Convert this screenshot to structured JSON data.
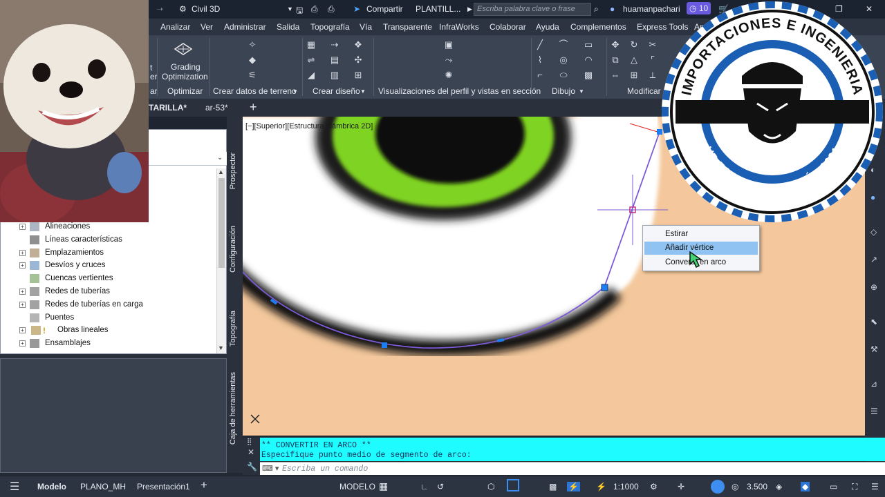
{
  "titlebar": {
    "workspace": "Civil 3D",
    "share": "Compartir",
    "doc_title": "PLANTILL...",
    "search_placeholder": "Escriba palabra clave o frase",
    "user": "huamanpachari",
    "notif_count": "10"
  },
  "menubar": [
    "Analizar",
    "Ver",
    "Administrar",
    "Salida",
    "Topografía",
    "Vía",
    "Transparente",
    "InfraWorks",
    "Colaborar",
    "Ayuda",
    "Complementos",
    "Express Tools",
    "Ap"
  ],
  "ribbon": {
    "grading_label_1": "Grading",
    "grading_label_2": "Optimization",
    "panels": [
      "Optimizar",
      "Crear datos de terreno",
      "Crear diseño",
      "Visualizaciones del perfil y vistas en sección",
      "Dibujo",
      "Modificar"
    ],
    "clipped_left": "ar",
    "clipped_left_top": "t",
    "clipped_left_mid": "er"
  },
  "doctabs": [
    "TARILLA*",
    "ar-53*"
  ],
  "toolspace": {
    "tree": [
      {
        "label": "Alineaciones",
        "expand": true
      },
      {
        "label": "Líneas características",
        "expand": false
      },
      {
        "label": "Emplazamientos",
        "expand": true
      },
      {
        "label": "Desvíos y cruces",
        "expand": true
      },
      {
        "label": "Cuencas vertientes",
        "expand": false
      },
      {
        "label": "Redes de tuberías",
        "expand": true
      },
      {
        "label": "Redes de tuberías en carga",
        "expand": true
      },
      {
        "label": "Puentes",
        "expand": false
      },
      {
        "label": "Obras lineales",
        "expand": true
      },
      {
        "label": "Ensamblajes",
        "expand": true
      }
    ]
  },
  "side_tabs": [
    "Prospector",
    "Configuración",
    "Topografía",
    "Caja de herramientas"
  ],
  "viewport": {
    "label": "[−][Superior][Estructura alámbrica 2D]",
    "ucs_label": "SCU"
  },
  "context_menu": {
    "items": [
      "Estirar",
      "Añadir vértice",
      "Convertir en arco"
    ],
    "active_index": 1
  },
  "command": {
    "history_1": "** CONVERTIR EN ARCO **",
    "history_2": "Especifique punto medio de segmento de arco:",
    "placeholder": "Escriba un comando"
  },
  "statusbar": {
    "tabs": [
      "Modelo",
      "PLANO_MH",
      "Presentación1"
    ],
    "space": "MODELO",
    "scale": "1:1000",
    "value": "3.500"
  },
  "logo": {
    "top_text": "IMPORTACIONES E INGENIERIA",
    "bottom_text": "HP FORMULION PERÚ - 2001"
  },
  "colors": {
    "cyan_cmd": "#1ffcff",
    "canvas_skin": "#f4c89c",
    "eye_green": "#7fd321",
    "menu_highlight": "#90c3f2",
    "logo_blue": "#1a5fb4"
  }
}
